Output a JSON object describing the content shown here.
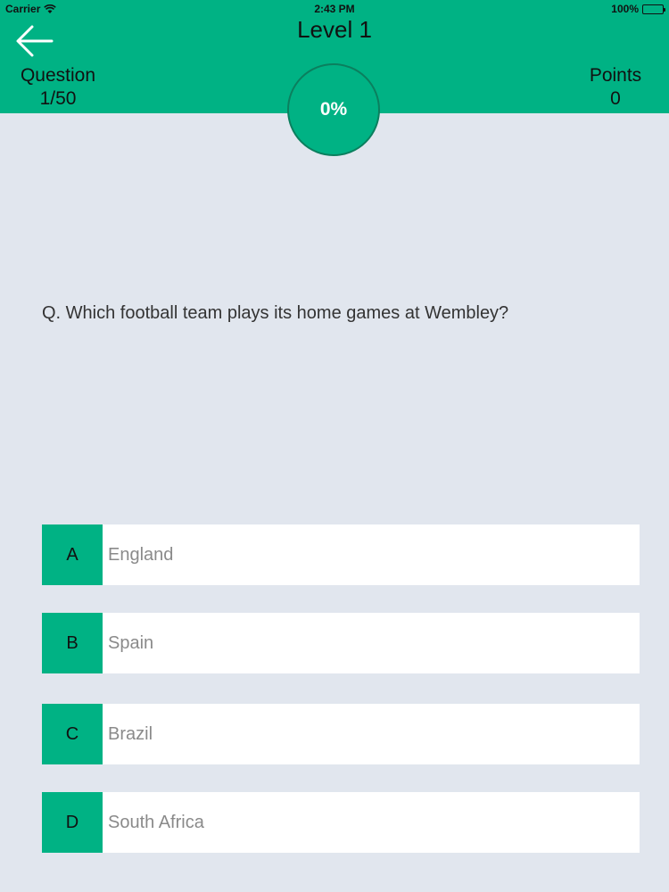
{
  "status_bar": {
    "carrier": "Carrier",
    "time": "2:43 PM",
    "battery": "100%",
    "icons": [
      "wifi-icon",
      "battery-icon"
    ]
  },
  "header": {
    "title": "Level 1",
    "question_label": "Question",
    "question_value": "1/50",
    "points_label": "Points",
    "points_value": "0",
    "progress": "0%",
    "back_icon": "arrow-left-icon"
  },
  "question": {
    "text": "Q. Which football team plays its home games at Wembley?"
  },
  "answers": [
    {
      "letter": "A",
      "text": "England"
    },
    {
      "letter": "B",
      "text": "Spain"
    },
    {
      "letter": "C",
      "text": "Brazil"
    },
    {
      "letter": "D",
      "text": "South Africa"
    }
  ],
  "colors": {
    "accent": "#00b284",
    "background": "#e1e6ee",
    "answer_text": "#8a8a8a"
  }
}
